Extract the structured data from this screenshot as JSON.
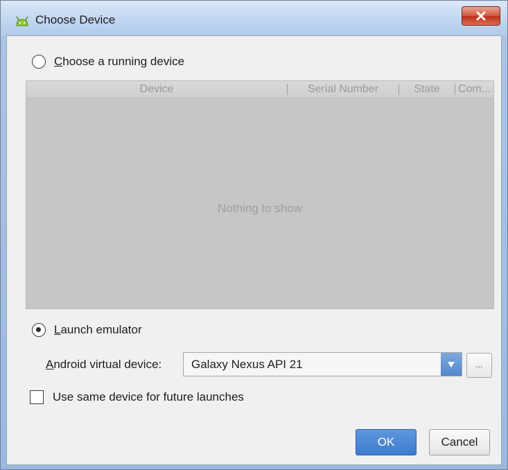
{
  "window": {
    "title": "Choose Device",
    "icon": "android-icon",
    "close_icon": "close-icon"
  },
  "running": {
    "label_prefix": "C",
    "label_rest": "hoose a running device",
    "selected": false
  },
  "table": {
    "columns": [
      "Device",
      "Serial Number",
      "State",
      "Com..."
    ],
    "empty_text": "Nothing to show"
  },
  "emulator": {
    "label_prefix": "L",
    "label_rest": "aunch emulator",
    "selected": true,
    "avd_label_prefix": "A",
    "avd_label_rest": "ndroid virtual device:",
    "avd_value": "Galaxy Nexus API 21",
    "ellipsis": "..."
  },
  "same_device": {
    "label": "Use same device for future launches",
    "checked": false
  },
  "buttons": {
    "ok": "OK",
    "cancel": "Cancel"
  },
  "colors": {
    "accent": "#4a86d0",
    "table_bg": "#c6c6c6"
  }
}
